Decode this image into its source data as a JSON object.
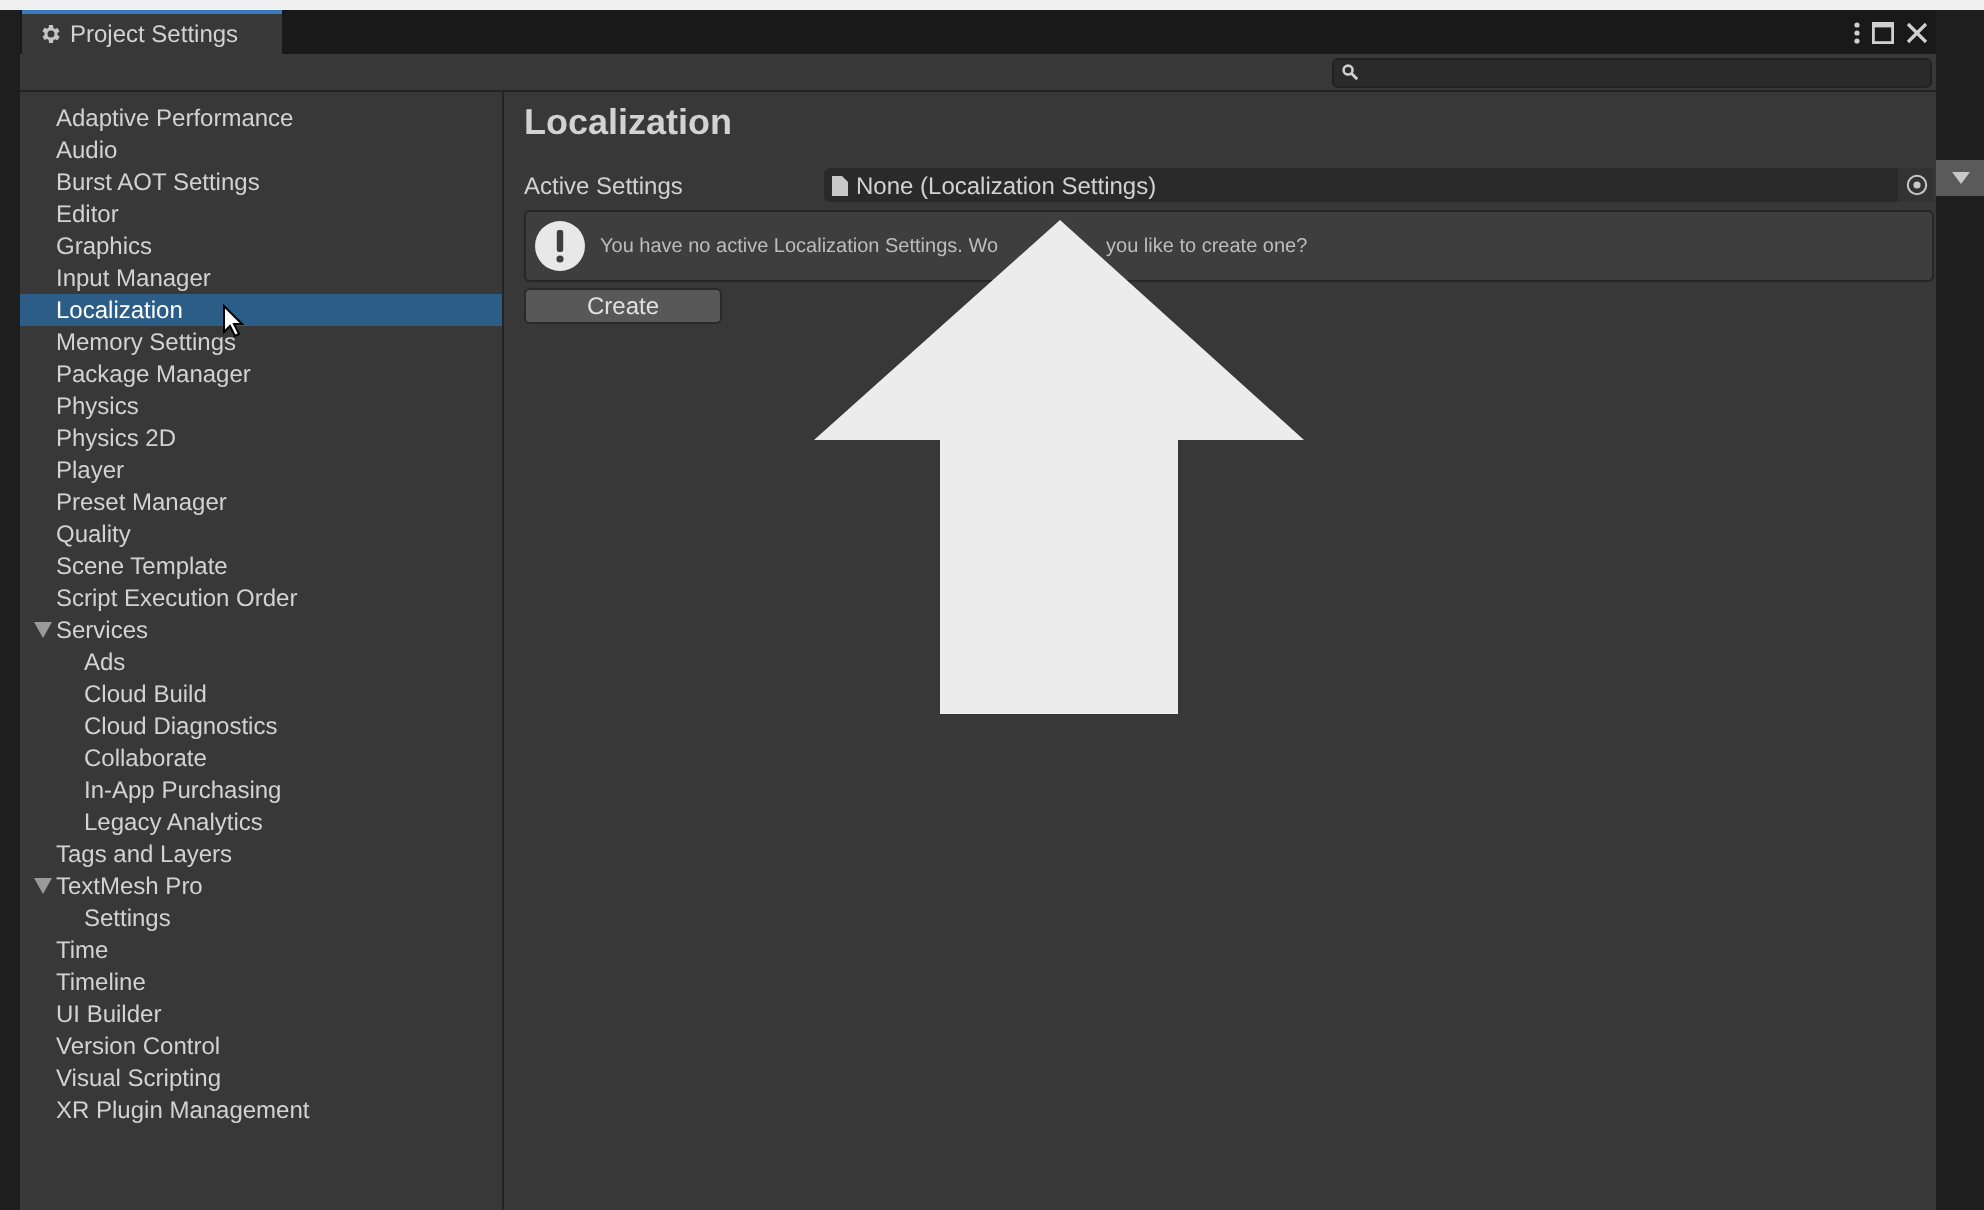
{
  "window": {
    "title": "Project Settings"
  },
  "sidebar": {
    "items": [
      {
        "label": "Adaptive Performance",
        "selected": false
      },
      {
        "label": "Audio",
        "selected": false
      },
      {
        "label": "Burst AOT Settings",
        "selected": false
      },
      {
        "label": "Editor",
        "selected": false
      },
      {
        "label": "Graphics",
        "selected": false
      },
      {
        "label": "Input Manager",
        "selected": false
      },
      {
        "label": "Localization",
        "selected": true
      },
      {
        "label": "Memory Settings",
        "selected": false
      },
      {
        "label": "Package Manager",
        "selected": false
      },
      {
        "label": "Physics",
        "selected": false
      },
      {
        "label": "Physics 2D",
        "selected": false
      },
      {
        "label": "Player",
        "selected": false
      },
      {
        "label": "Preset Manager",
        "selected": false
      },
      {
        "label": "Quality",
        "selected": false
      },
      {
        "label": "Scene Template",
        "selected": false
      },
      {
        "label": "Script Execution Order",
        "selected": false
      },
      {
        "label": "Services",
        "selected": false,
        "expanded": true,
        "children": [
          {
            "label": "Ads",
            "selected": false
          },
          {
            "label": "Cloud Build",
            "selected": false
          },
          {
            "label": "Cloud Diagnostics",
            "selected": false
          },
          {
            "label": "Collaborate",
            "selected": false
          },
          {
            "label": "In-App Purchasing",
            "selected": false
          },
          {
            "label": "Legacy Analytics",
            "selected": false
          }
        ]
      },
      {
        "label": "Tags and Layers",
        "selected": false
      },
      {
        "label": "TextMesh Pro",
        "selected": false,
        "expanded": true,
        "children": [
          {
            "label": "Settings",
            "selected": false
          }
        ]
      },
      {
        "label": "Time",
        "selected": false
      },
      {
        "label": "Timeline",
        "selected": false
      },
      {
        "label": "UI Builder",
        "selected": false
      },
      {
        "label": "Version Control",
        "selected": false
      },
      {
        "label": "Visual Scripting",
        "selected": false
      },
      {
        "label": "XR Plugin Management",
        "selected": false
      }
    ]
  },
  "panel": {
    "title": "Localization",
    "field_label": "Active Settings",
    "field_value": "None (Localization Settings)",
    "help_text_before": "You have no active Localization Settings. Wo",
    "help_text_after": "you like to create one?",
    "button": "Create"
  }
}
